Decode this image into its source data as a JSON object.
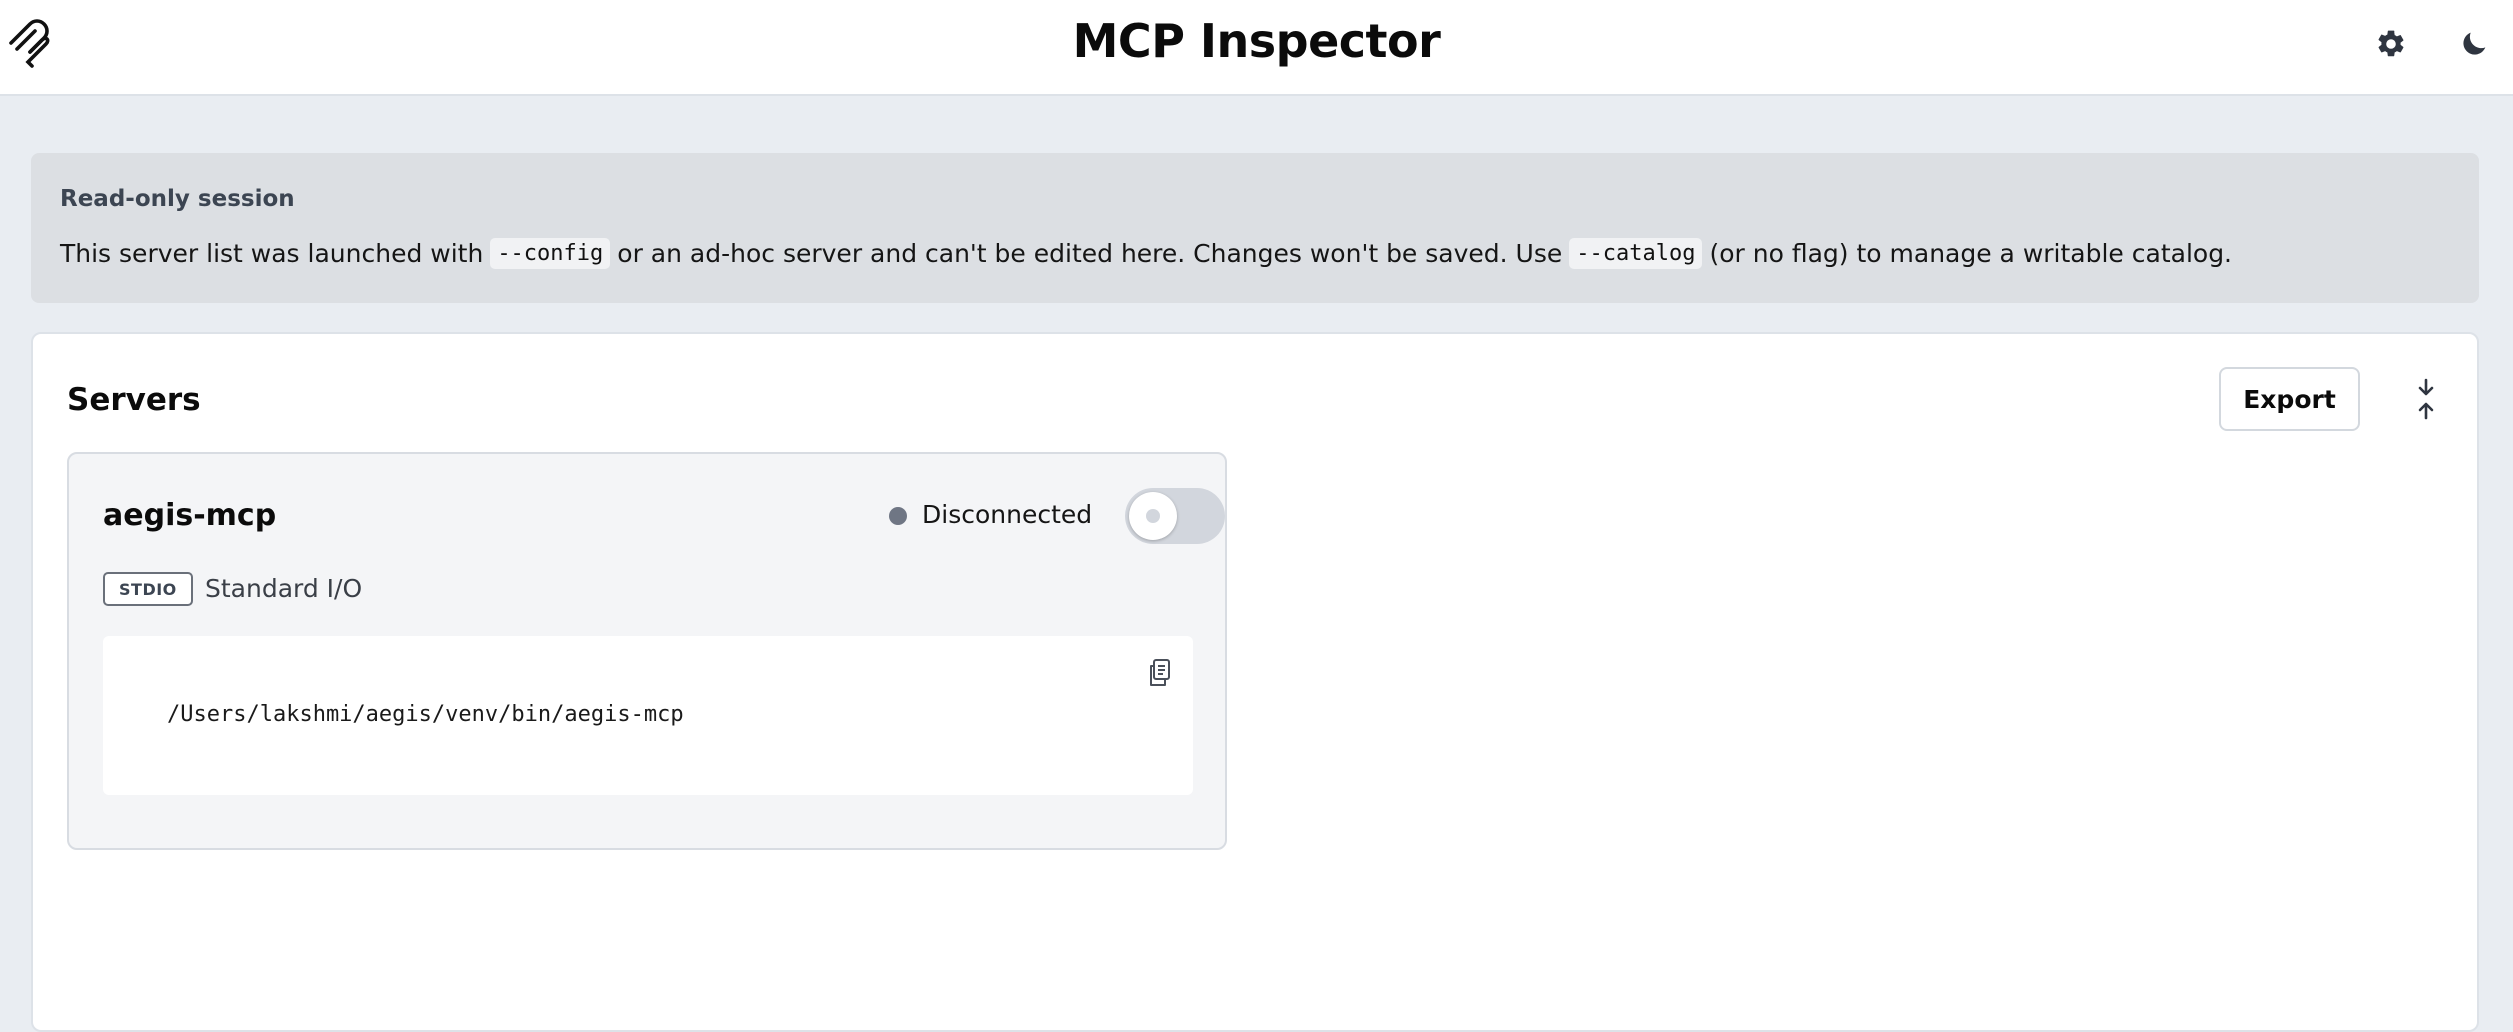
{
  "header": {
    "app_title": "MCP Inspector",
    "logo_icon": "mcp-logo-icon",
    "settings_icon": "gear-icon",
    "theme_icon": "moon-icon"
  },
  "banner": {
    "title": "Read-only session",
    "text_before_config": "This server list was launched with",
    "config_flag": "--config",
    "text_middle": "or an ad-hoc server and can't be edited here. Changes won't be saved. Use",
    "catalog_flag": "--catalog",
    "text_after": "(or no flag) to manage a writable catalog."
  },
  "servers": {
    "title": "Servers",
    "export_label": "Export",
    "collapse_icon": "collapse-icon",
    "items": [
      {
        "name": "aegis-mcp",
        "status": "Disconnected",
        "status_color": "#6f7684",
        "enabled": false,
        "transport_badge": "STDIO",
        "transport_label": "Standard I/O",
        "command": "/Users/lakshmi/aegis/venv/bin/aegis-mcp",
        "copy_icon": "copy-icon"
      }
    ]
  },
  "colors": {
    "page_bg": "#e9edf2",
    "banner_bg": "#dcdfe3",
    "card_bg": "#f4f5f7",
    "toggle_off": "#d2d6dd"
  }
}
